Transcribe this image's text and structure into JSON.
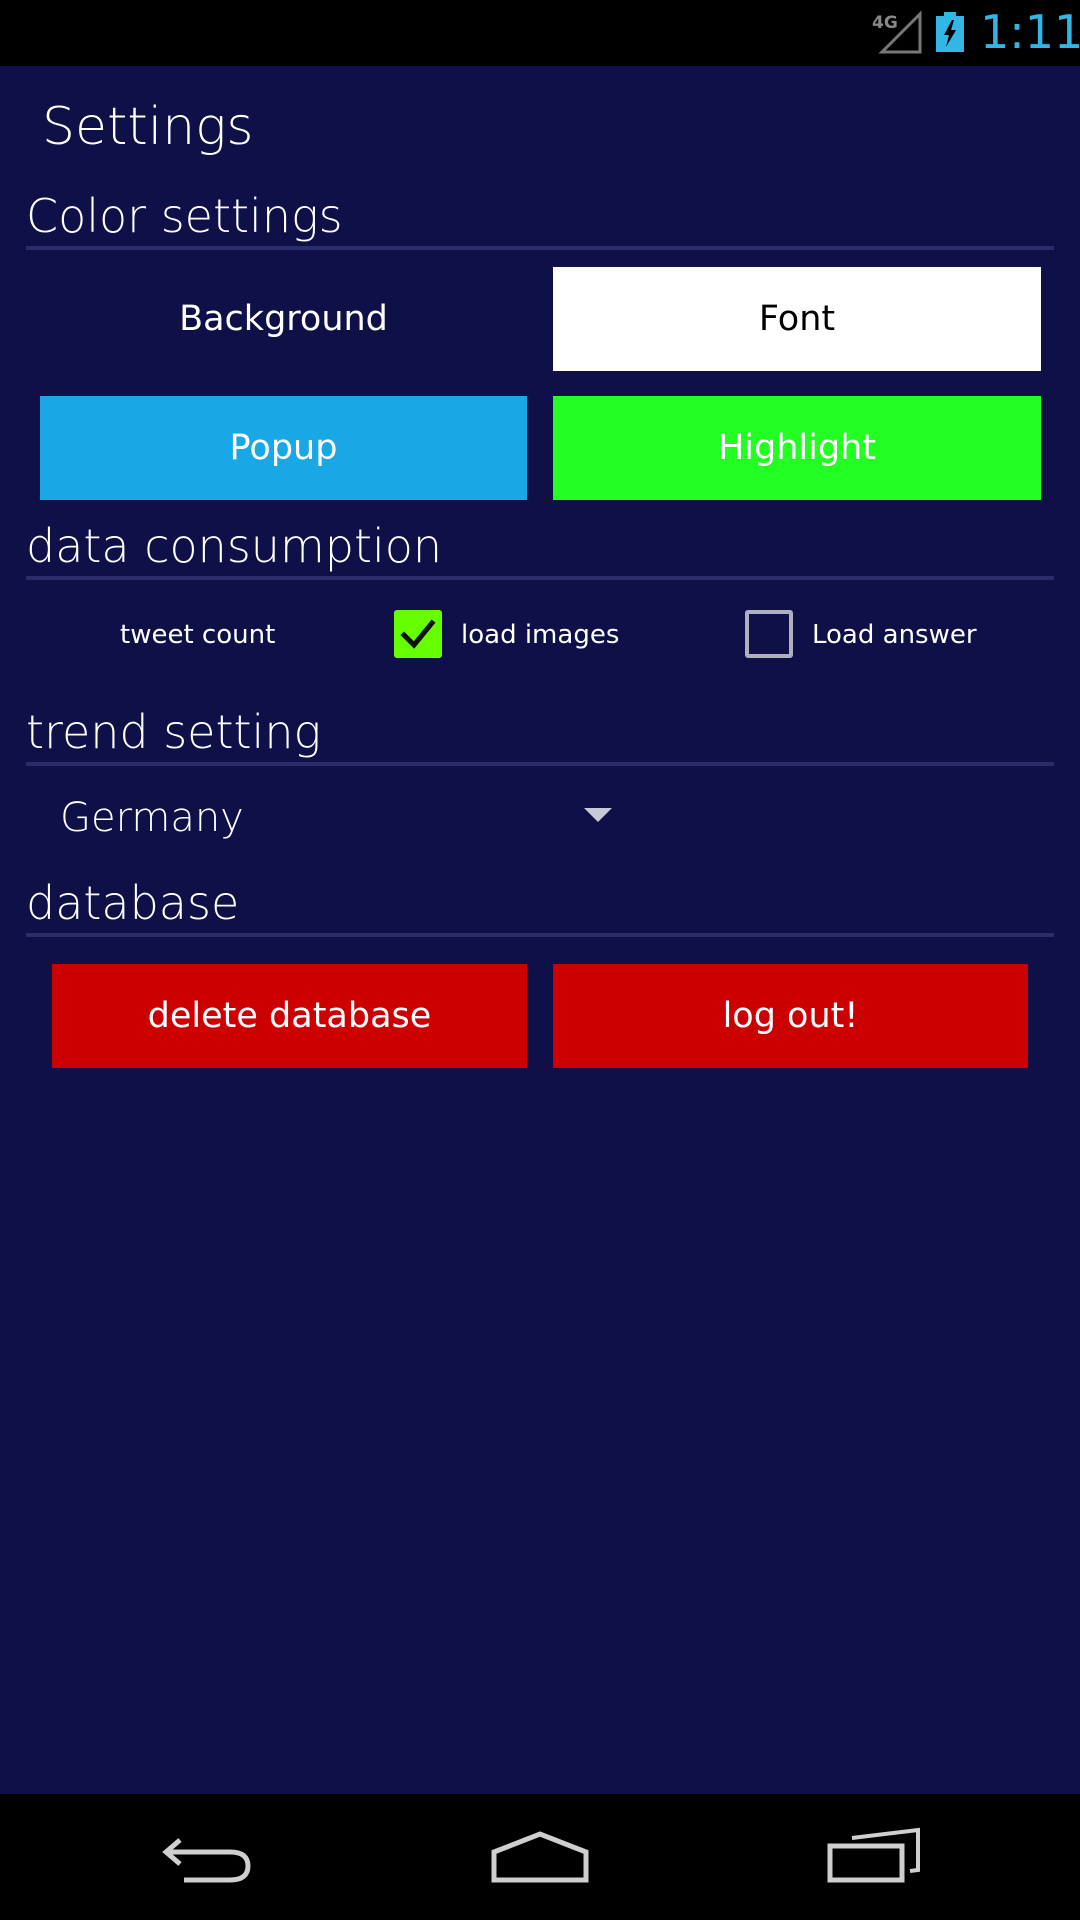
{
  "status_bar": {
    "network": "4G",
    "time": "1:11",
    "time_color": "#33b5e5"
  },
  "page": {
    "title": "Settings",
    "background_color": "#0f1047"
  },
  "color_settings": {
    "heading": "Color settings",
    "buttons": [
      {
        "label": "Background",
        "bg": "#0f1047",
        "fg": "#ffffff"
      },
      {
        "label": "Font",
        "bg": "#ffffff",
        "fg": "#000000"
      },
      {
        "label": "Popup",
        "bg": "#1aa7e6",
        "fg": "#ffffff"
      },
      {
        "label": "Highlight",
        "bg": "#22ff22",
        "fg": "#ffffff"
      }
    ]
  },
  "data_consumption": {
    "heading": "data consumption",
    "tweet_count_label": "tweet count",
    "load_images_label": "load images",
    "load_images_checked": true,
    "load_answer_label": "Load answer",
    "load_answer_checked": false
  },
  "trend_setting": {
    "heading": "trend setting",
    "selected_country": "Germany"
  },
  "database": {
    "heading": "database",
    "delete_label": "delete database",
    "logout_label": "log out!",
    "button_color": "#cc0000"
  },
  "nav_bar": {
    "icons": [
      "back-icon",
      "home-icon",
      "recent-apps-icon"
    ]
  }
}
